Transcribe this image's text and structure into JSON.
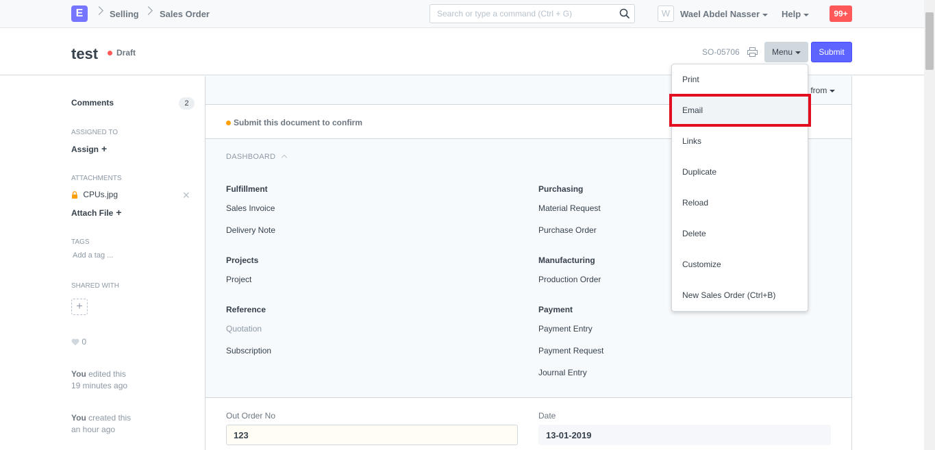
{
  "navbar": {
    "logo": "E",
    "breadcrumbs": [
      "Selling",
      "Sales Order"
    ],
    "search_placeholder": "Search or type a command (Ctrl + G)",
    "avatar_initial": "W",
    "user_name": "Wael Abdel Nasser",
    "help_label": "Help",
    "notifications": "99+"
  },
  "page": {
    "title": "test",
    "status": "Draft",
    "status_color": "#ff5858",
    "doc_id": "SO-05706",
    "menu_label": "Menu",
    "submit_label": "Submit"
  },
  "menu_items": [
    "Print",
    "Email",
    "Links",
    "Duplicate",
    "Reload",
    "Delete",
    "Customize",
    "New Sales Order (Ctrl+B)"
  ],
  "sidebar": {
    "comments_label": "Comments",
    "comments_count": "2",
    "assigned_heading": "ASSIGNED TO",
    "assign_label": "Assign",
    "attachments_heading": "ATTACHMENTS",
    "attachment_file": "CPUs.jpg",
    "attach_file_label": "Attach File",
    "tags_heading": "TAGS",
    "tag_placeholder": "Add a tag ...",
    "shared_heading": "SHARED WITH",
    "likes": "0",
    "activity": [
      {
        "actor": "You",
        "action": " edited this",
        "time": "19 minutes ago"
      },
      {
        "actor": "You",
        "action": " created this",
        "time": "an hour ago"
      }
    ]
  },
  "toolbar": {
    "get_items_partial": "s from"
  },
  "confirm_message": "Submit this document to confirm",
  "dashboard": {
    "heading": "DASHBOARD",
    "groups": {
      "fulfillment": {
        "title": "Fulfillment",
        "links": [
          "Sales Invoice",
          "Delivery Note"
        ]
      },
      "purchasing": {
        "title": "Purchasing",
        "links": [
          "Material Request",
          "Purchase Order"
        ]
      },
      "projects": {
        "title": "Projects",
        "links": [
          "Project"
        ]
      },
      "manufacturing": {
        "title": "Manufacturing",
        "links": [
          "Production Order"
        ]
      },
      "reference": {
        "title": "Reference",
        "links": [
          "Quotation",
          "Subscription"
        ]
      },
      "payment": {
        "title": "Payment",
        "links": [
          "Payment Entry",
          "Payment Request",
          "Journal Entry"
        ]
      }
    }
  },
  "form": {
    "out_order_label": "Out Order No",
    "out_order_value": "123",
    "date_label": "Date",
    "date_value": "13-01-2019"
  },
  "colors": {
    "accent": "#5e64ff",
    "highlight_border": "#e30d20",
    "warning_dot": "#ffa00a"
  }
}
